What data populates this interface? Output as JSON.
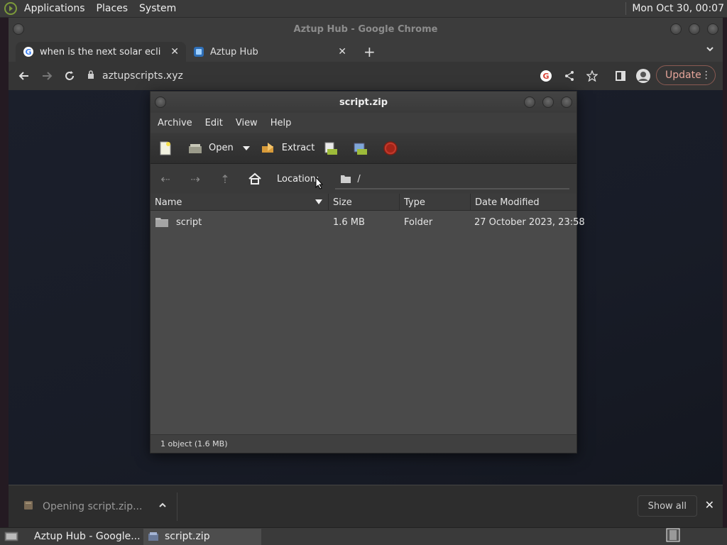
{
  "top_panel": {
    "menus": [
      "Applications",
      "Places",
      "System"
    ],
    "clock": "Mon Oct 30, 00:07"
  },
  "chrome": {
    "window_title": "Aztup Hub - Google Chrome",
    "tabs": [
      {
        "label": "when is the next solar eclipse",
        "active": true
      },
      {
        "label": "Aztup Hub",
        "active": false
      }
    ],
    "url": "aztupscripts.xyz",
    "update_label": "Update"
  },
  "download_bar": {
    "item_label": "Opening script.zip...",
    "show_all_label": "Show all"
  },
  "archive": {
    "title": "script.zip",
    "menus": [
      "Archive",
      "Edit",
      "View",
      "Help"
    ],
    "toolbar": {
      "open_label": "Open",
      "extract_label": "Extract"
    },
    "location_label": "Location:",
    "location_path": "/",
    "columns": [
      "Name",
      "Size",
      "Type",
      "Date Modified"
    ],
    "rows": [
      {
        "name": "script",
        "size": "1.6 MB",
        "type": "Folder",
        "date": "27 October 2023, 23:58"
      }
    ],
    "status": "1 object (1.6 MB)"
  },
  "taskbar": {
    "tasks": [
      {
        "label": "Aztup Hub - Google...",
        "active": false
      },
      {
        "label": "script.zip",
        "active": true
      }
    ]
  },
  "colors": {
    "update_accent": "#e6a59a",
    "record_red": "#c0392b"
  }
}
